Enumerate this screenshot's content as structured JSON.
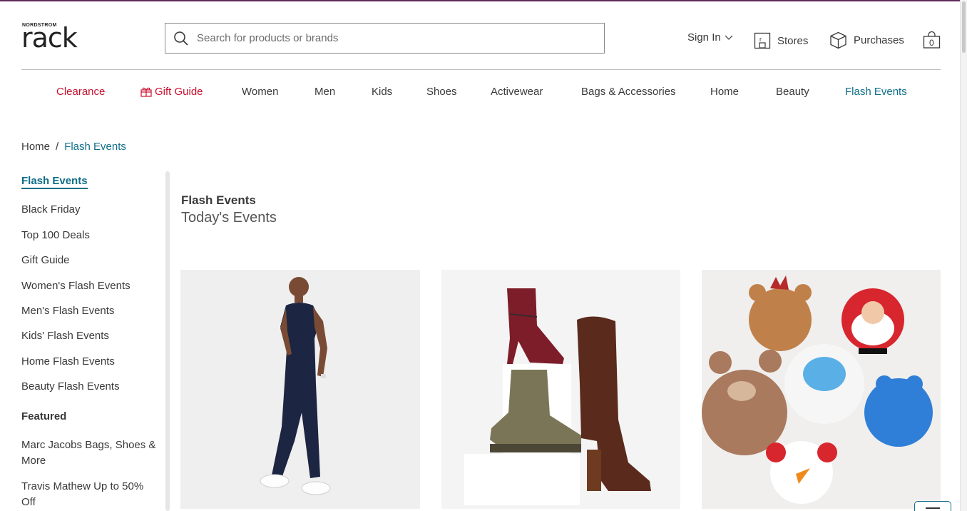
{
  "header": {
    "logo_small": "NORDSTROM",
    "logo_big": "rack",
    "search_placeholder": "Search for products or brands",
    "sign_in": "Sign In",
    "stores": "Stores",
    "purchases": "Purchases",
    "bag_count": "0"
  },
  "nav": [
    {
      "label": "Clearance"
    },
    {
      "label": "Gift Guide"
    },
    {
      "label": "Women"
    },
    {
      "label": "Men"
    },
    {
      "label": "Kids"
    },
    {
      "label": "Shoes"
    },
    {
      "label": "Activewear"
    },
    {
      "label": "Bags & Accessories"
    },
    {
      "label": "Home"
    },
    {
      "label": "Beauty"
    },
    {
      "label": "Flash Events"
    }
  ],
  "breadcrumb": {
    "home": "Home",
    "sep": "/",
    "current": "Flash Events"
  },
  "sidebar": {
    "active": "Flash Events",
    "items": [
      "Black Friday",
      "Top 100 Deals",
      "Gift Guide",
      "Women's Flash Events",
      "Men's Flash Events",
      "Kids' Flash Events",
      "Home Flash Events",
      "Beauty Flash Events"
    ],
    "featured_heading": "Featured",
    "featured": [
      "Marc Jacobs Bags, Shoes & More",
      "Travis Mathew Up to 50% Off"
    ]
  },
  "main": {
    "heading": "Flash Events",
    "subheading": "Today's Events"
  },
  "colors": {
    "accent_teal": "#0f6e88",
    "clearance_red": "#c8102e",
    "top_bar": "#5e2b5a"
  },
  "icons": [
    "search-icon",
    "chevron-down-icon",
    "store-icon",
    "box-icon",
    "bag-icon",
    "gift-icon"
  ]
}
